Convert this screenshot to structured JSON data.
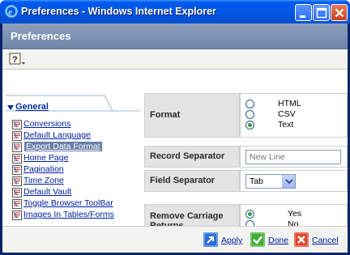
{
  "window": {
    "title": "Preferences - Windows Internet Explorer",
    "controls": [
      "minimize-icon",
      "maximize-icon",
      "close-icon"
    ]
  },
  "page": {
    "header_title": "Preferences"
  },
  "toolbar": {
    "help_icon": "help-icon"
  },
  "nav": {
    "header": "General",
    "items": [
      {
        "label": "Conversions",
        "selected": false
      },
      {
        "label": "Default Language",
        "selected": false
      },
      {
        "label": "Export Data Format",
        "selected": true
      },
      {
        "label": "Home Page",
        "selected": false
      },
      {
        "label": "Pagination",
        "selected": false
      },
      {
        "label": "Time Zone",
        "selected": false
      },
      {
        "label": "Default Vault",
        "selected": false
      },
      {
        "label": "Toggle Browser ToolBar",
        "selected": false
      },
      {
        "label": "Images In Tables/Forms",
        "selected": false
      }
    ]
  },
  "form": {
    "format": {
      "label": "Format",
      "options": [
        {
          "label": "HTML",
          "checked": false
        },
        {
          "label": "CSV",
          "checked": false
        },
        {
          "label": "Text",
          "checked": true
        }
      ]
    },
    "record_separator": {
      "label": "Record Separator",
      "value": "",
      "placeholder": "New Line"
    },
    "field_separator": {
      "label": "Field Separator",
      "selected": "Tab"
    },
    "remove_carriage_returns": {
      "label": "Remove Carriage Returns",
      "options": [
        {
          "label": "Yes",
          "checked": true
        },
        {
          "label": "No",
          "checked": false
        }
      ]
    }
  },
  "footer": {
    "apply_label": "Apply",
    "done_label": "Done",
    "cancel_label": "Cancel"
  },
  "colors": {
    "titlebar": "#0058e6",
    "header": "#7b90b2",
    "selected_nav": "#6a7fa8",
    "link": "#0020a0"
  }
}
